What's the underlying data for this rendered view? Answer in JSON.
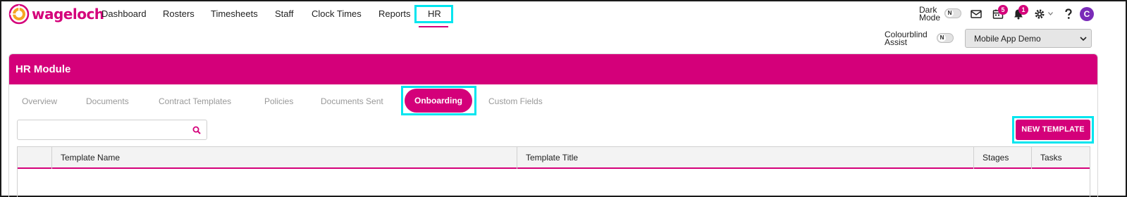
{
  "app": {
    "brand": "wageloch",
    "brand_color": "#d4007a",
    "highlight_color": "#00e5ef"
  },
  "nav": {
    "items": [
      "Dashboard",
      "Rosters",
      "Timesheets",
      "Staff",
      "Clock Times",
      "Reports",
      "HR"
    ],
    "active": "HR"
  },
  "header_tools": {
    "dark_mode_label_1": "Dark",
    "dark_mode_label_2": "Mode",
    "dark_mode_toggle": "N",
    "colourblind_label_1": "Colourblind",
    "colourblind_label_2": "Assist",
    "colourblind_toggle": "N",
    "calendar_badge": "5",
    "notification_badge": "1",
    "avatar_initial": "C",
    "icons": [
      "mail-icon",
      "calendar-icon",
      "bell-icon",
      "gear-icon",
      "help-icon"
    ],
    "org_select": "Mobile App Demo"
  },
  "panel": {
    "title": "HR Module",
    "tabs": [
      "Overview",
      "Documents",
      "Contract Templates",
      "Policies",
      "Documents Sent",
      "Onboarding",
      "Custom Fields"
    ],
    "active_tab": "Onboarding",
    "search": {
      "value": "",
      "placeholder": ""
    },
    "new_template_label": "NEW TEMPLATE",
    "table": {
      "columns": [
        "",
        "Template Name",
        "Template Title",
        "Stages",
        "Tasks"
      ],
      "rows": []
    }
  }
}
